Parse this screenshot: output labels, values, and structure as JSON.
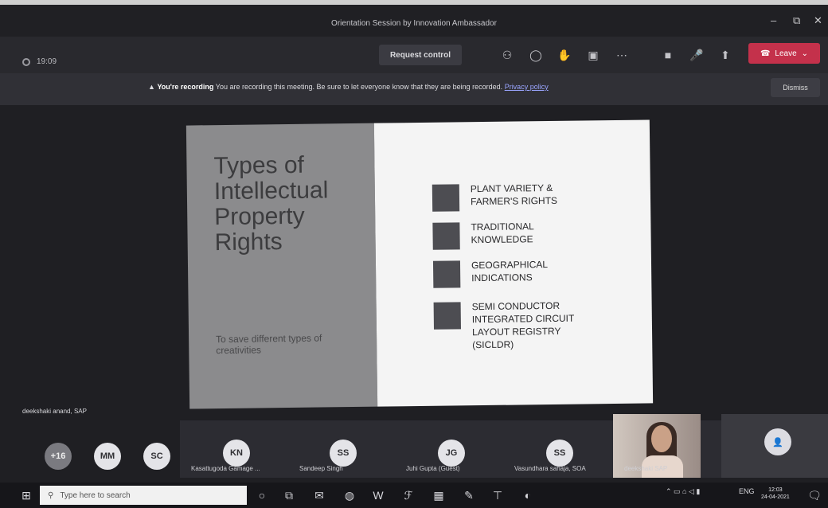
{
  "window": {
    "title": "Orientation Session by Innovation Ambassador",
    "min": "–",
    "max": "⧉",
    "close": "✕"
  },
  "toolbar": {
    "timer": "19:09",
    "request_control": "Request control",
    "leave": "Leave",
    "icons": [
      "participants-icon",
      "chat-icon",
      "raise-hand-icon",
      "rooms-icon",
      "more-icon",
      "camera-icon",
      "mic-icon",
      "share-icon"
    ]
  },
  "banner": {
    "strong": "You're recording",
    "message": "You are recording this meeting. Be sure to let everyone know that they are being recorded.",
    "link": "Privacy policy",
    "dismiss": "Dismiss"
  },
  "slide": {
    "title": "Types of Intellectual Property Rights",
    "subtitle": "To save different types of creativities",
    "items": [
      "PLANT VARIETY &\nFARMER'S RIGHTS",
      "TRADITIONAL\nKNOWLEDGE",
      "GEOGRAPHICAL\nINDICATIONS",
      "SEMI CONDUCTOR\nINTEGRATED CIRCUIT\nLAYOUT REGISTRY\n(SICLDR)"
    ]
  },
  "stage": {
    "speaker": "deekshaki anand, SAP"
  },
  "participants": [
    {
      "initials": "+16",
      "name": ""
    },
    {
      "initials": "MM",
      "name": ""
    },
    {
      "initials": "SC",
      "name": ""
    },
    {
      "initials": "KN",
      "name": "Kasattugoda Gamage ..."
    },
    {
      "initials": "SS",
      "name": "Sandeep Singh"
    },
    {
      "initials": "JG",
      "name": "Juhi Gupta (Guest)"
    },
    {
      "initials": "SS",
      "name": "Vasundhara sahaja, SOA"
    }
  ],
  "webcam_name": "deekshaki SAP",
  "taskbar": {
    "search_placeholder": "Type here to search",
    "lang": "ENG",
    "time": "12:03",
    "date": "24-04-2021"
  }
}
